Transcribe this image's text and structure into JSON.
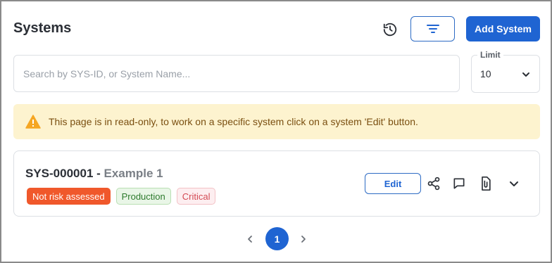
{
  "header": {
    "title": "Systems",
    "history_icon": "history-icon",
    "filter_icon": "filter-icon",
    "add_button_label": "Add System"
  },
  "search": {
    "placeholder": "Search by SYS-ID, or System Name...",
    "value": ""
  },
  "limit": {
    "label": "Limit",
    "value": "10",
    "icon": "chevron-down-icon"
  },
  "alert": {
    "icon": "warning-icon",
    "text": "This page is in read-only, to work on a specific system click on a system 'Edit' button."
  },
  "systems": [
    {
      "id": "SYS-000001 - ",
      "name": "Example 1",
      "badges": {
        "risk": "Not risk assessed",
        "environment": "Production",
        "criticality": "Critical"
      },
      "edit_label": "Edit",
      "actions": [
        "share-icon",
        "comment-icon",
        "attachment-icon",
        "chevron-down-icon"
      ]
    }
  ],
  "pagination": {
    "current_page": "1",
    "prev_icon": "chevron-left-icon",
    "next_icon": "chevron-right-icon"
  },
  "colors": {
    "primary": "#1f64d2",
    "alert_bg": "#fdf3cf",
    "alert_icon": "#f5a623",
    "risk_badge": "#f0582b",
    "production_badge_bg": "#e9f6e7",
    "critical_badge_bg": "#fdeef0"
  }
}
